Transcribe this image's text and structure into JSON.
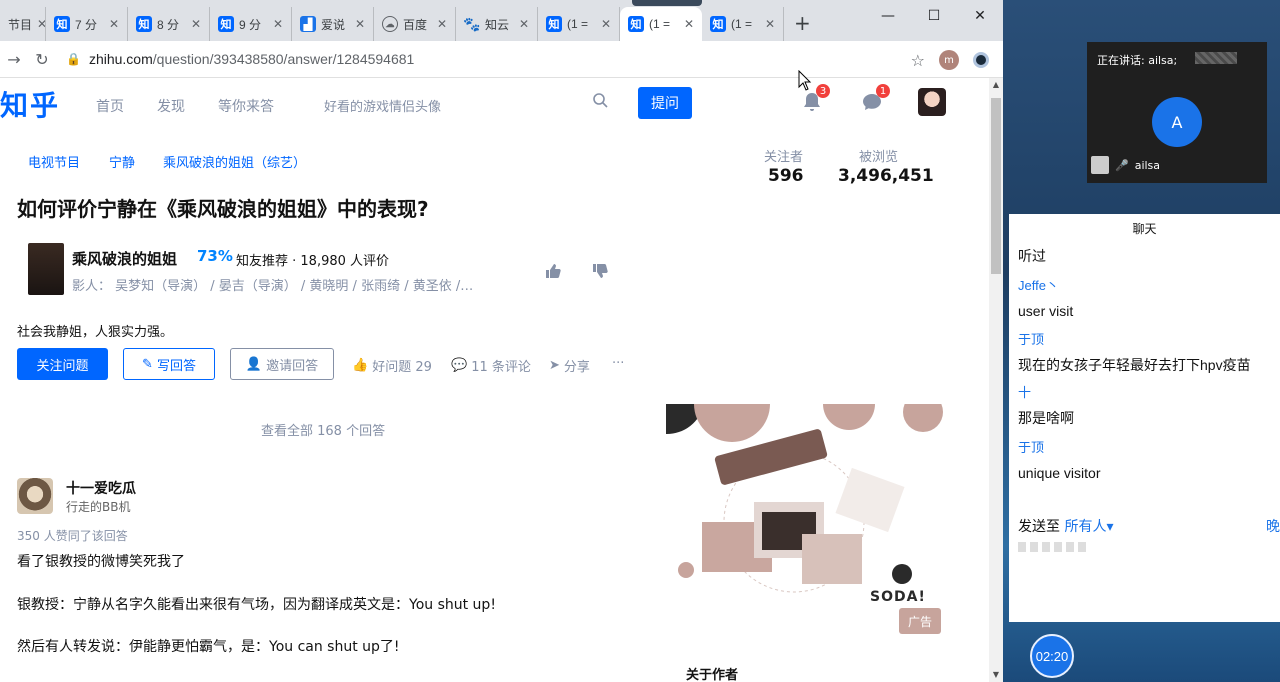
{
  "browser": {
    "tabs": [
      {
        "label": "节目",
        "icon": "none"
      },
      {
        "label": "7 分",
        "icon": "zhihu"
      },
      {
        "label": "8 分",
        "icon": "zhihu"
      },
      {
        "label": "9 分",
        "icon": "zhihu"
      },
      {
        "label": "爱说",
        "icon": "chart"
      },
      {
        "label": "百度",
        "icon": "cloud"
      },
      {
        "label": "知云",
        "icon": "paw"
      },
      {
        "label": "(1 =",
        "icon": "zhihu"
      },
      {
        "label": "(1 =",
        "icon": "zhihu"
      },
      {
        "label": "(1 =",
        "icon": "zhihu"
      }
    ],
    "new_tab": "+",
    "window_controls": {
      "minimize": "—",
      "maximize": "☐",
      "close": "✕"
    },
    "url_host": "zhihu.com",
    "url_path": "/question/393438580/answer/1284594681",
    "profile_initial": "m"
  },
  "zhihu": {
    "logo": "知乎",
    "nav": [
      "首页",
      "发现",
      "等你来答"
    ],
    "search_placeholder": "好看的游戏情侣头像",
    "ask_button": "提问",
    "notif_count": "3",
    "msg_count": "1",
    "topics": [
      "电视节目",
      "宁静",
      "乘风破浪的姐姐（综艺）"
    ],
    "stats": {
      "followers_label": "关注者",
      "followers": "596",
      "views_label": "被浏览",
      "views": "3,496,451"
    },
    "question_title": "如何评价宁静在《乘风破浪的姐姐》中的表现?",
    "show": {
      "name": "乘风破浪的姐姐",
      "percent": "73%",
      "recommend": "知友推荐 · 18,980 人评价",
      "cast": "影人：  吴梦知（导演） / 晏吉（导演） / 黄晓明 / 张雨绮 / 黄圣依 /…"
    },
    "question_detail": "社会我静姐，人狠实力强。",
    "actions": {
      "follow": "关注问题",
      "write": "写回答",
      "invite": "邀请回答",
      "good_question": "好问题 29",
      "comments": "11 条评论",
      "share": "分享",
      "more": "···"
    },
    "view_all": "查看全部 168 个回答",
    "answer": {
      "author": "十一爱吃瓜",
      "bio": "行走的BB机",
      "agree": "350 人赞同了该回答",
      "lines": [
        "看了银教授的微博笑死我了",
        "银教授：宁静从名字久能看出来很有气场，因为翻译成英文是：You shut up!",
        "然后有人转发说：伊能静更怕霸气，是：You can shut up了!"
      ]
    },
    "about_author": "关于作者",
    "ad": {
      "brand": "SODA!",
      "label": "广告"
    }
  },
  "meeting": {
    "speaking": "正在讲话: ailsa;",
    "avatar_letter": "A",
    "participant": "ailsa",
    "chat_title": "聊天",
    "chat": [
      {
        "kind": "msg",
        "text": "听过"
      },
      {
        "kind": "name",
        "text": "Jeffe丶"
      },
      {
        "kind": "msg",
        "text": "user visit"
      },
      {
        "kind": "name",
        "text": "于顶"
      },
      {
        "kind": "msg",
        "text": "现在的女孩子年轻最好去打下hpv疫苗"
      },
      {
        "kind": "name",
        "text": "十"
      },
      {
        "kind": "msg",
        "text": "那是啥啊"
      },
      {
        "kind": "name",
        "text": "于顶"
      },
      {
        "kind": "msg",
        "text": "unique  visitor"
      }
    ],
    "send_to_label": "发送至 ",
    "send_to_target": "所有人▾",
    "edge_char": "晚",
    "timer": "02:20"
  }
}
